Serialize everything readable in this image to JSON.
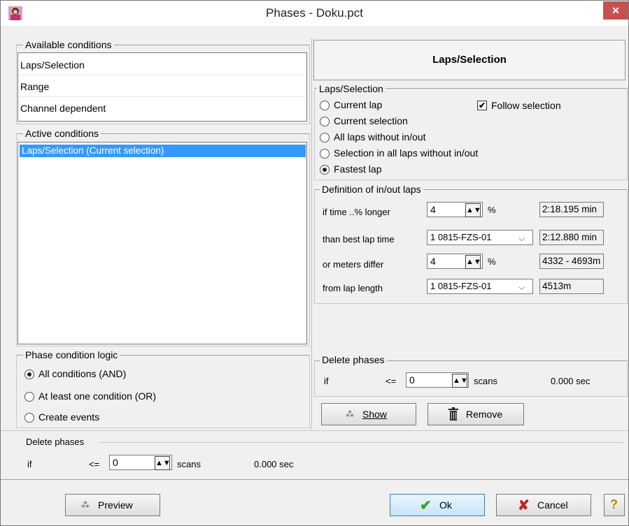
{
  "window": {
    "title": "Phases - Doku.pct",
    "close_glyph": "✕"
  },
  "available": {
    "label": "Available conditions",
    "items": [
      "Laps/Selection",
      "Range",
      "Channel dependent"
    ]
  },
  "active": {
    "label": "Active conditions",
    "items": [
      "Laps/Selection  (Current selection)"
    ]
  },
  "logic": {
    "label": "Phase condition logic",
    "options": [
      "All conditions (AND)",
      "At least one condition (OR)",
      "Create events"
    ],
    "selected": 0
  },
  "bottom_delete": {
    "label": "Delete phases",
    "if": "if",
    "op": "<=",
    "value": "0",
    "unit": "scans",
    "time": "0.000  sec"
  },
  "panel": {
    "header": "Laps/Selection",
    "group_label": "Laps/Selection",
    "options": [
      "Current lap",
      "Current selection",
      "All laps without in/out",
      "Selection in all laps without in/out",
      "Fastest lap"
    ],
    "selected": 4,
    "follow_selection": {
      "label": "Follow selection",
      "checked": true,
      "check_glyph": "✔"
    }
  },
  "inout": {
    "label": "Definition of in/out laps",
    "rows": [
      {
        "label": "if time ..% longer",
        "value": "4",
        "unit": "%",
        "readout": "2:18.195 min"
      },
      {
        "label": "than best lap time",
        "value": "1  0815-FZS-01",
        "readout": "2:12.880 min"
      },
      {
        "label": "or meters differ",
        "value": "4",
        "unit": "%",
        "readout": "4332 - 4693m"
      },
      {
        "label": "from lap length",
        "value": "1  0815-FZS-01",
        "readout": "4513m"
      }
    ]
  },
  "right_delete": {
    "label": "Delete phases",
    "if": "if",
    "op": "<=",
    "value": "0",
    "unit": "scans",
    "time": "0.000  sec"
  },
  "buttons": {
    "show": "Show",
    "remove": "Remove",
    "preview": "Preview",
    "ok": "Ok",
    "cancel": "Cancel",
    "help_glyph": "?"
  },
  "icons": {
    "spin": "spin-updown-icon",
    "combo": "chevron-down-icon",
    "ok": "checkmark-icon",
    "cancel": "x-mark-icon",
    "remove": "trash-icon",
    "show": "show-icon",
    "preview": "preview-icon",
    "help": "help-icon"
  },
  "colors": {
    "selection": "#3399ff",
    "close": "#c75050",
    "ok_check": "#3aa02c",
    "cancel_x": "#c0261f"
  }
}
